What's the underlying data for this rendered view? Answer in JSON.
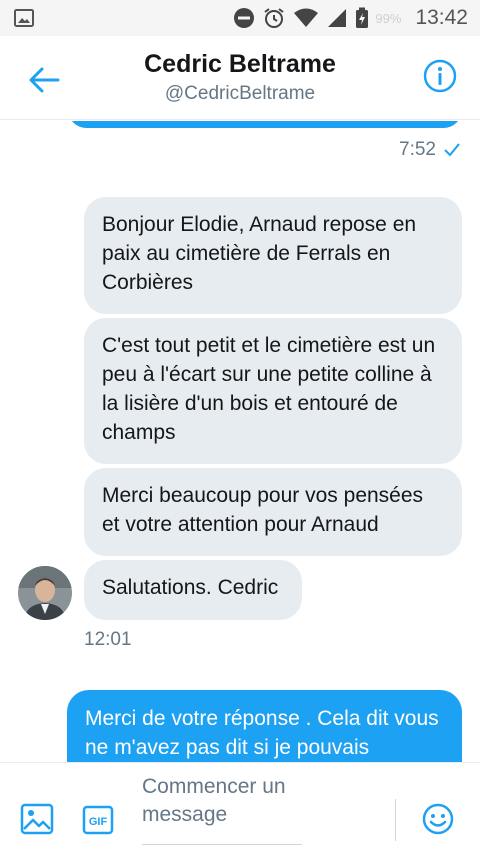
{
  "status_bar": {
    "battery": "99%",
    "time": "13:42"
  },
  "header": {
    "name": "Cedric Beltrame",
    "handle": "@CedricBeltrame"
  },
  "conversation": {
    "sent_time": "7:52",
    "received": [
      "Bonjour Elodie, Arnaud repose en paix au cimetière de Ferrals en Corbières",
      "C'est tout petit et le cimetière est un peu à l'écart sur une petite colline à la lisière d'un bois et entouré de champs",
      "Merci beaucoup pour vos pensées et votre attention pour Arnaud",
      "Salutations. Cedric"
    ],
    "received_time": "12:01",
    "sent_message": "Merci de votre réponse . Cela dit vous ne m'avez pas dit si je pouvais"
  },
  "composer": {
    "placeholder": "Commencer un message"
  },
  "colors": {
    "accent": "#1da1f2",
    "received_bubble": "#e6ecf0"
  },
  "icons": [
    "back-arrow-icon",
    "info-icon",
    "image-icon",
    "gif-icon",
    "emoji-icon"
  ]
}
